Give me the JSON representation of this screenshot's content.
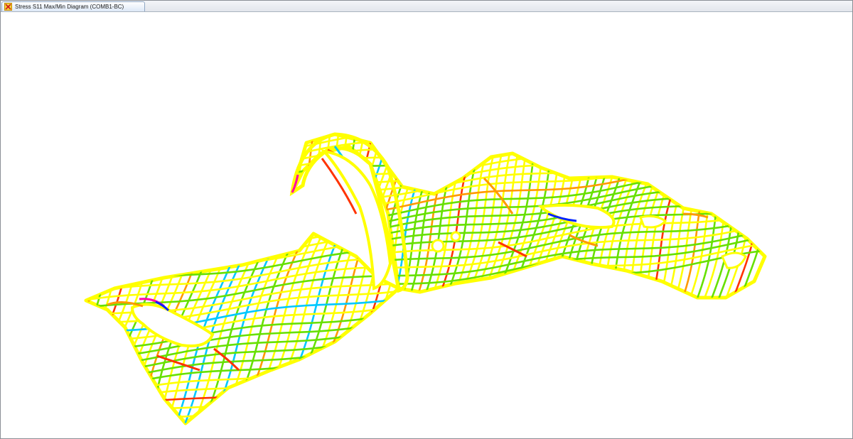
{
  "window": {
    "tab_title": "Stress S11 Max/Min Diagram  (COMB1-BC)",
    "tab_icon": "structure-model-icon"
  },
  "viewport": {
    "content": "stress-contour-model",
    "background_color": "#ffffff",
    "mesh_colors": {
      "dominant": "#ffff00",
      "secondary": "#66e000",
      "moderate": "#ff9900",
      "high": "#ff3300",
      "low": "#00c8ff",
      "lowest": "#0022ff",
      "peak": "#ff00aa"
    }
  }
}
